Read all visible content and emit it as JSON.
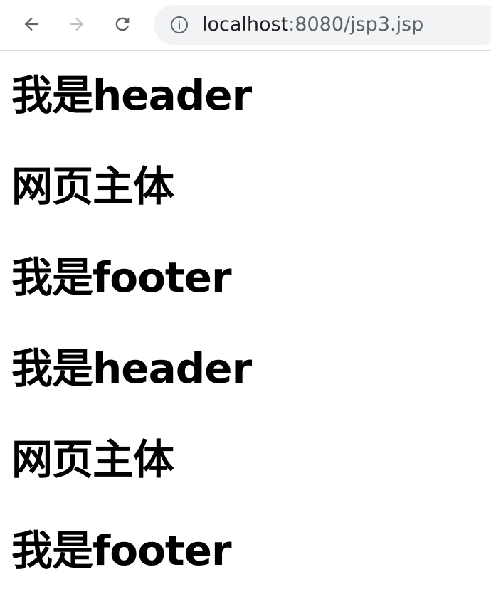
{
  "browser": {
    "url_host": "localhost",
    "url_rest": ":8080/jsp3.jsp",
    "icons": {
      "back": "arrow-left-icon",
      "forward": "arrow-right-icon",
      "reload": "reload-icon",
      "site_info": "info-icon"
    },
    "colors": {
      "icon_active": "#5f6368",
      "icon_disabled": "#bdc1c6",
      "omnibox_bg": "#f1f3f4"
    }
  },
  "page": {
    "lines": [
      "我是header",
      "网页主体",
      "我是footer",
      "我是header",
      "网页主体",
      "我是footer"
    ]
  }
}
